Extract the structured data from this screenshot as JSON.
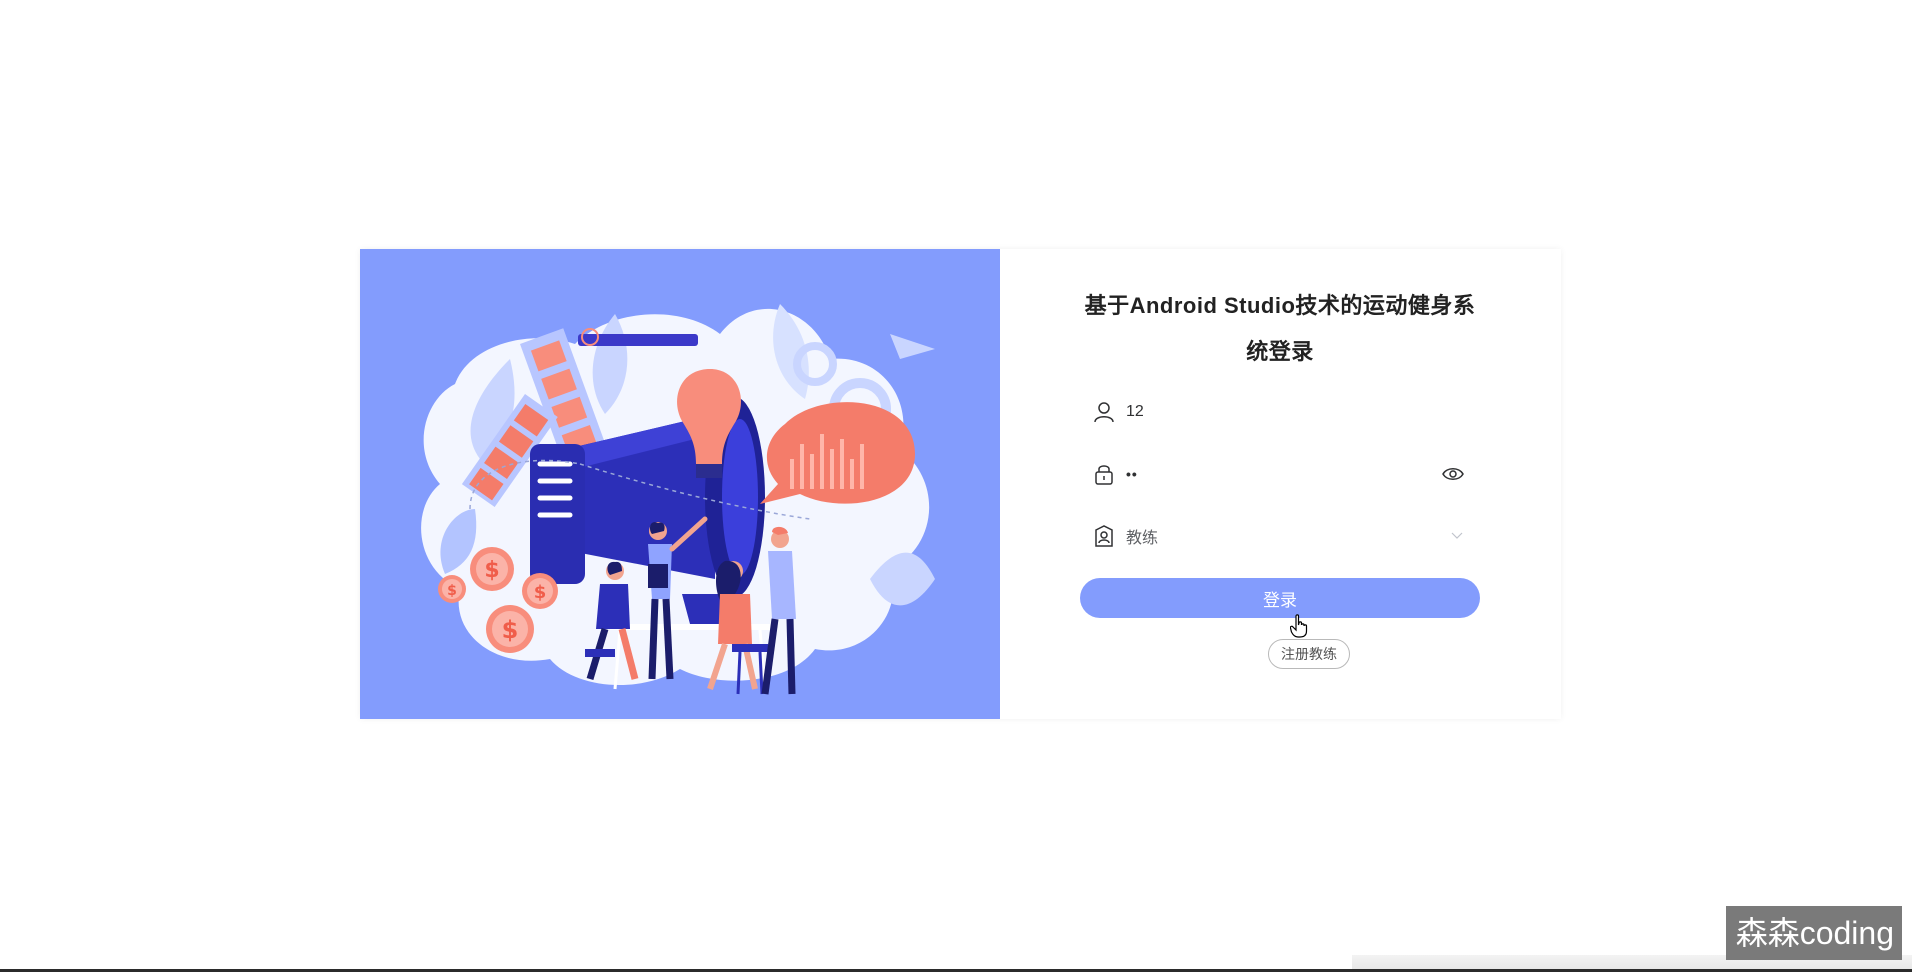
{
  "page": {
    "title_line1": "基于Android Studio技术的运动健身系",
    "title_line2": "统登录"
  },
  "form": {
    "username_value": "12",
    "password_value": "••",
    "role_value": "教练",
    "login_label": "登录",
    "register_label": "注册教练"
  },
  "icons": {
    "user": "user-icon",
    "lock": "lock-icon",
    "eye": "eye-icon",
    "role": "role-icon",
    "chevron": "chevron-down-icon"
  },
  "colors": {
    "accent": "#839cfd",
    "text": "#222222"
  },
  "watermark": {
    "text": "森森coding"
  }
}
